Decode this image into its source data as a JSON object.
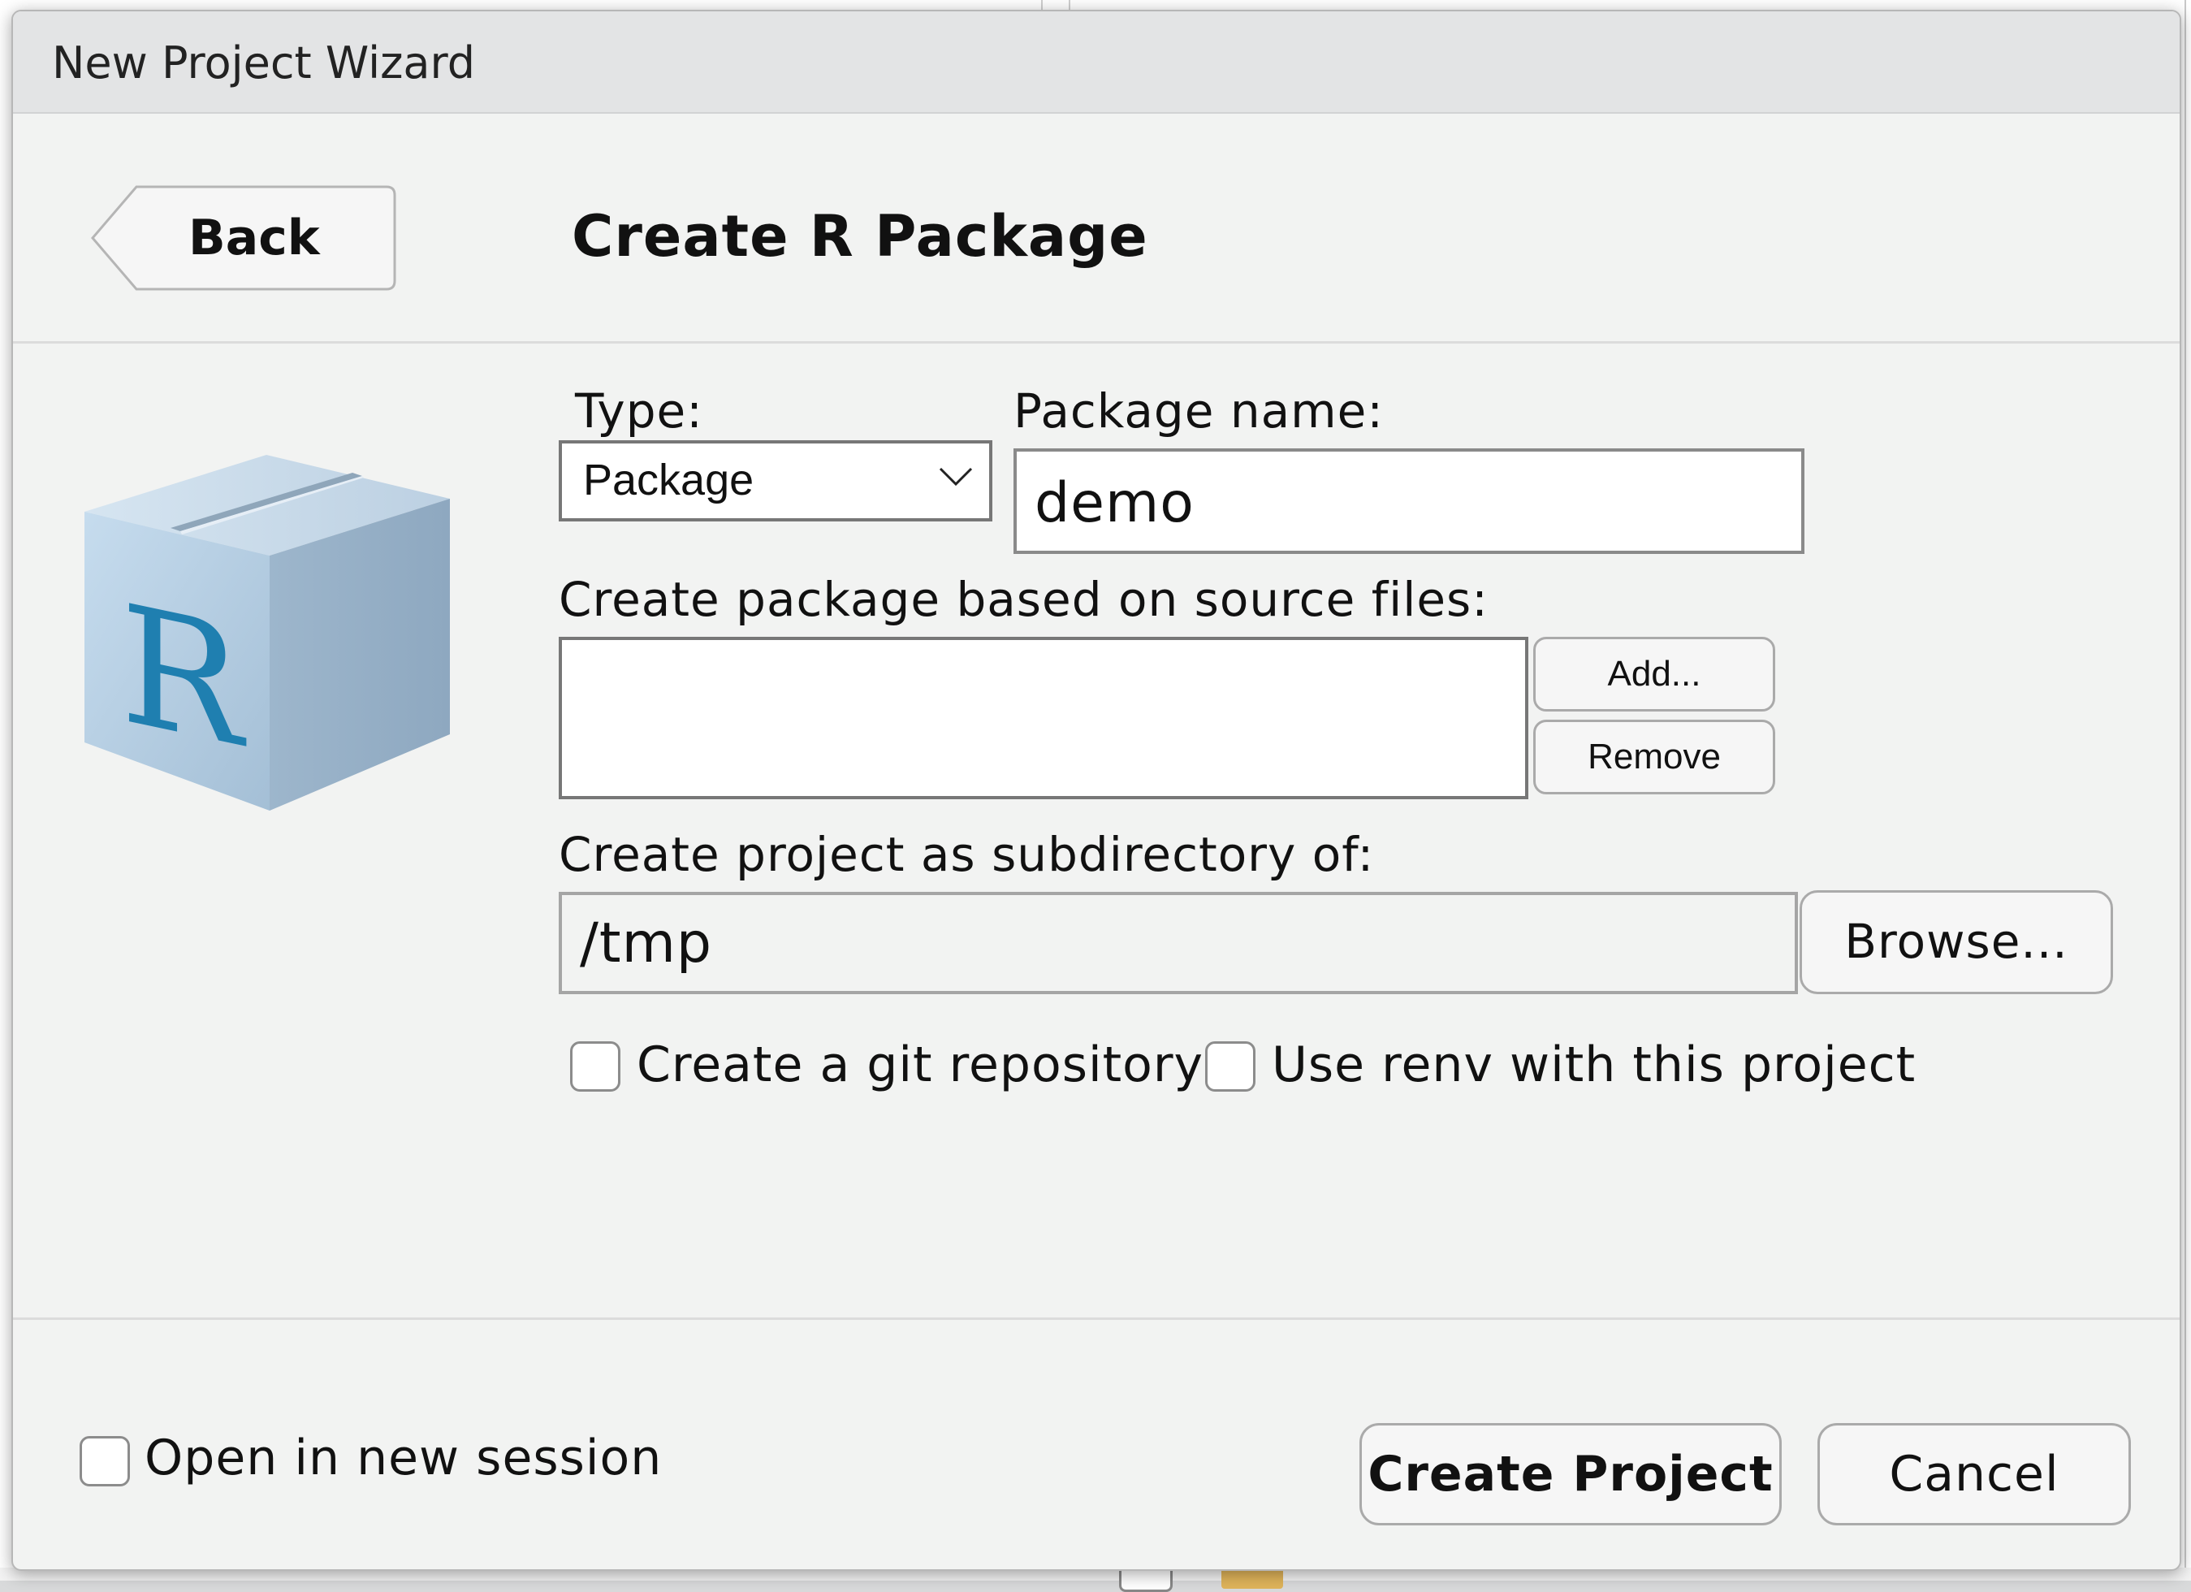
{
  "dialog": {
    "title": "New Project Wizard",
    "back_label": "Back",
    "page_title": "Create R Package"
  },
  "form": {
    "type_label": "Type:",
    "type_selected": "Package",
    "package_name_label": "Package name:",
    "package_name_value": "demo",
    "source_files_label": "Create package based on source files:",
    "add_label": "Add...",
    "remove_label": "Remove",
    "subdirectory_label": "Create project as subdirectory of:",
    "subdirectory_value": "/tmp",
    "browse_label": "Browse...",
    "git_label": "Create a git repository",
    "git_checked": false,
    "renv_label": "Use renv with this project",
    "renv_checked": false
  },
  "footer": {
    "new_session_label": "Open in new session",
    "new_session_checked": false,
    "create_label": "Create Project",
    "cancel_label": "Cancel"
  },
  "icons": {
    "package_icon": "r-package-box-icon",
    "dropdown_icon": "chevron-down-icon",
    "back_arrow": "back-arrow-shape"
  },
  "colors": {
    "dialog_background": "#f2f3f2",
    "titlebar_background": "#e3e4e5",
    "r_logo_blue": "#1f7fb0",
    "box_blue": "#a9c4db"
  }
}
